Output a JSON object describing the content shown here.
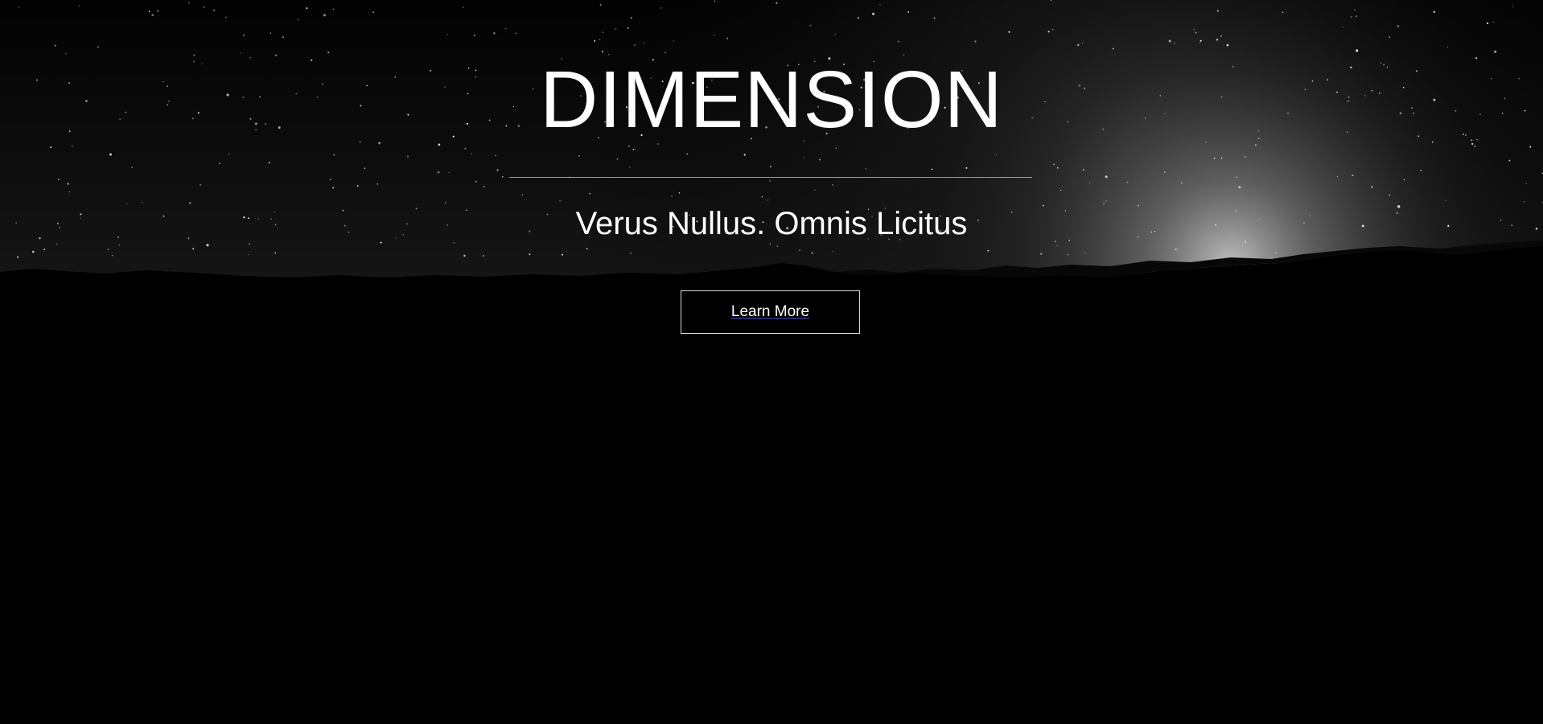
{
  "hero": {
    "title": "DIMENSION",
    "subtitle": "Verus Nullus. Omnis Licitus",
    "cta_label": "Learn More"
  },
  "background": {
    "description_icon": "night-sky-mountain-icon",
    "colors": {
      "sky_top": "#000000",
      "glow": "#bdbdbd",
      "ground": "#000000"
    }
  },
  "colors": {
    "text": "#ffffff",
    "divider": "#9a9a9a",
    "button_border": "#d9d9d9",
    "link_underline": "#3b3bff"
  }
}
